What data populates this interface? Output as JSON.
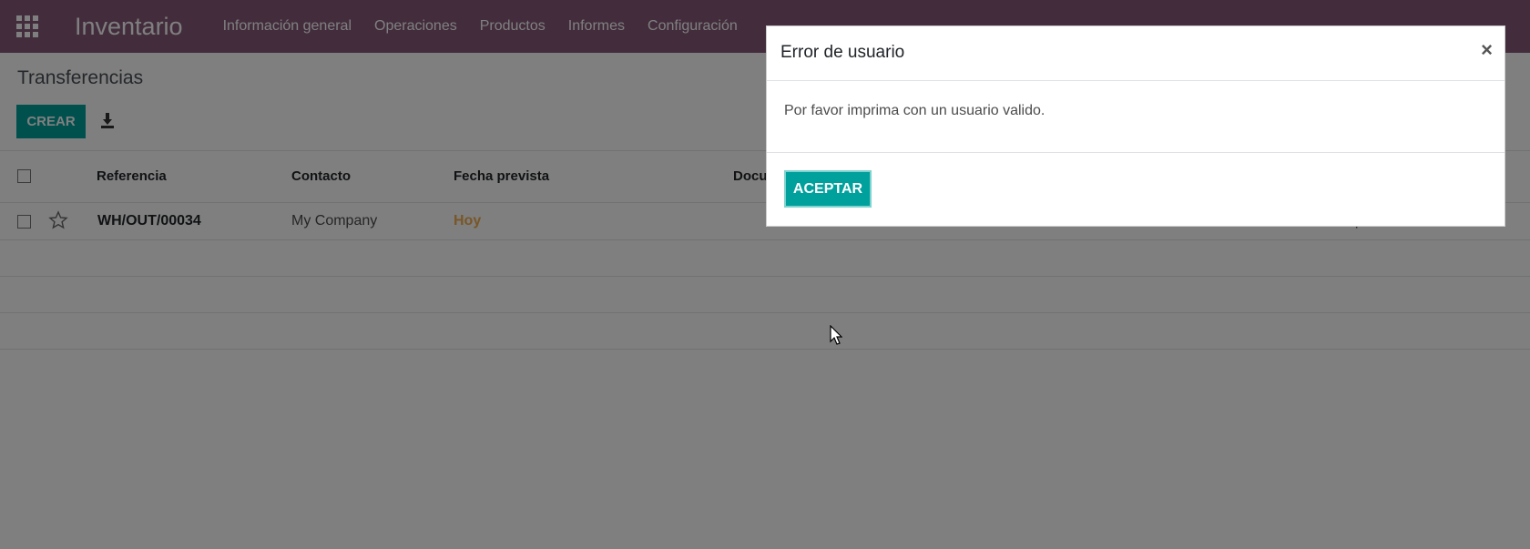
{
  "navbar": {
    "brand": "Inventario",
    "menu": [
      "Información general",
      "Operaciones",
      "Productos",
      "Informes",
      "Configuración"
    ],
    "color": "#875a7b"
  },
  "control": {
    "title": "Transferencias",
    "create_label": "CREAR",
    "accent": "#00a09d"
  },
  "table": {
    "headers": [
      "Referencia",
      "Contacto",
      "Fecha prevista",
      "Docu"
    ],
    "rows": [
      {
        "reference": "WH/OUT/00034",
        "contact": "My Company",
        "date": "Hoy",
        "truncated_right": "San Francisco: Expediciones"
      }
    ]
  },
  "dialog": {
    "title": "Error de usuario",
    "close": "×",
    "message": "Por favor imprima con un usuario valido.",
    "accept_label": "ACEPTAR"
  }
}
